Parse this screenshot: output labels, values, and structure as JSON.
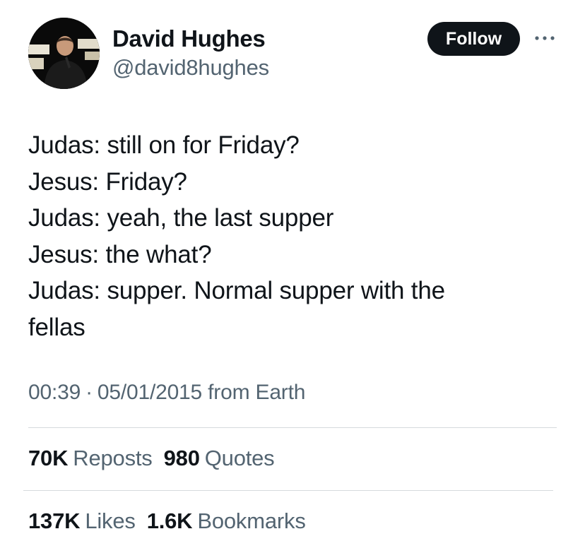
{
  "author": {
    "name": "David Hughes",
    "handle": "@david8hughes",
    "avatar_icon": "profile-photo"
  },
  "follow_label": "Follow",
  "more_icon": "more-horizontal-icon",
  "tweet": {
    "lines": [
      "Judas: still on for Friday?",
      "Jesus: Friday?",
      "Judas: yeah, the last supper",
      "Jesus: the what?",
      "Judas: supper. Normal supper with the",
      "fellas"
    ]
  },
  "meta": {
    "time": "00:39",
    "separator": "·",
    "date": "05/01/2015",
    "source": "from Earth"
  },
  "stats": {
    "reposts": {
      "value": "70K",
      "label": "Reposts"
    },
    "quotes": {
      "value": "980",
      "label": "Quotes"
    },
    "likes": {
      "value": "137K",
      "label": "Likes"
    },
    "bookmarks": {
      "value": "1.6K",
      "label": "Bookmarks"
    }
  },
  "colors": {
    "text": "#0f1419",
    "secondary": "#536471",
    "button_bg": "#0f1419",
    "divider": "#d6dadd"
  }
}
